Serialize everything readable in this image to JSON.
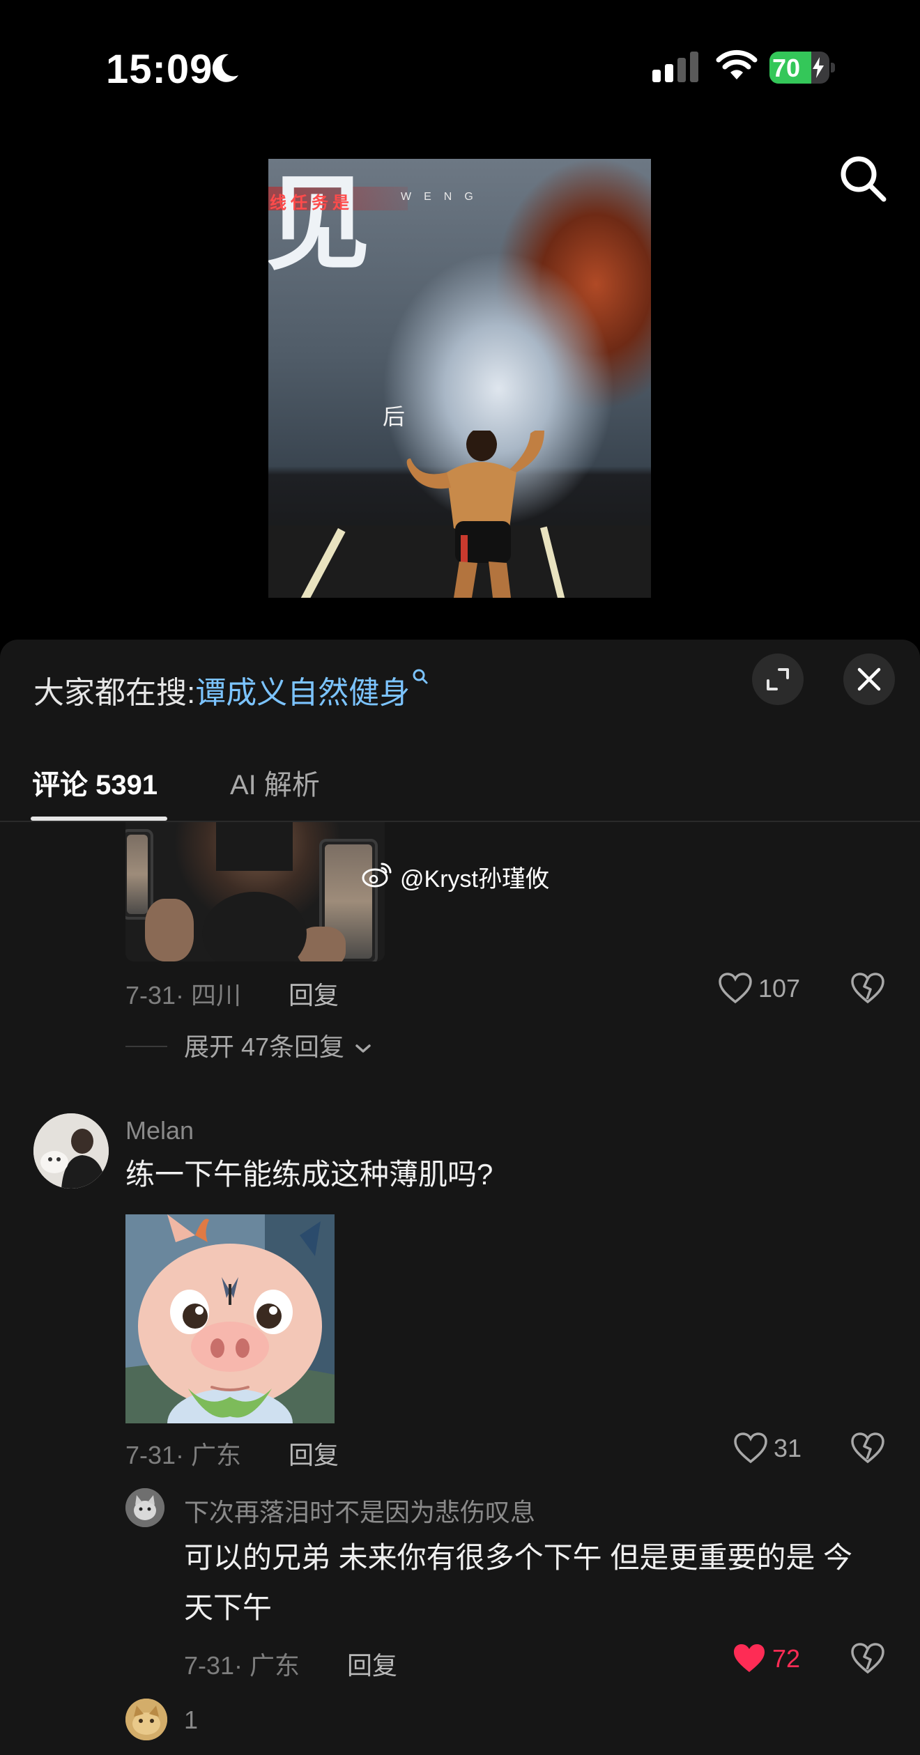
{
  "status_bar": {
    "time": "15:09",
    "battery": {
      "level": "70",
      "level_fraction": 0.7,
      "charging": true,
      "color": "#34c759"
    },
    "signal_bars": 2,
    "icons": [
      "moon-icon",
      "cellular-signal-icon",
      "wifi-icon",
      "battery-icon"
    ]
  },
  "video": {
    "thumb_big_text": "见",
    "thumb_line_text": "线任务是",
    "thumb_weng_text": "WENG",
    "thumb_small_text": "后",
    "search_icon": "search-icon"
  },
  "sheet": {
    "search_prefix": "大家都在搜:",
    "search_keyword": "谭成义自然健身",
    "expand_icon": "expand-icon",
    "close_icon": "close-icon",
    "tabs": [
      {
        "label": "评论 5391",
        "active": true
      },
      {
        "label": "AI 解析",
        "active": false
      }
    ]
  },
  "comments": [
    {
      "watermark": "@Kryst孙瑾攸",
      "date_location": "7-31· 四川",
      "reply_label": "回复",
      "likes": "107",
      "liked": false,
      "expand_replies": "展开 47条回复"
    },
    {
      "username": "Melan",
      "text": "练一下午能练成这种薄肌吗?",
      "date_location": "7-31· 广东",
      "reply_label": "回复",
      "likes": "31",
      "liked": false
    },
    {
      "username": "下次再落泪时不是因为悲伤叹息",
      "text_line1": "可以的兄弟 未来你有很多个下午 但是更重要的是 今",
      "text_line2": "天下午",
      "date_location": "7-31· 广东",
      "reply_label": "回复",
      "likes": "72",
      "liked": true,
      "like_color": "#fe2c55"
    },
    {
      "username": "1"
    }
  ]
}
